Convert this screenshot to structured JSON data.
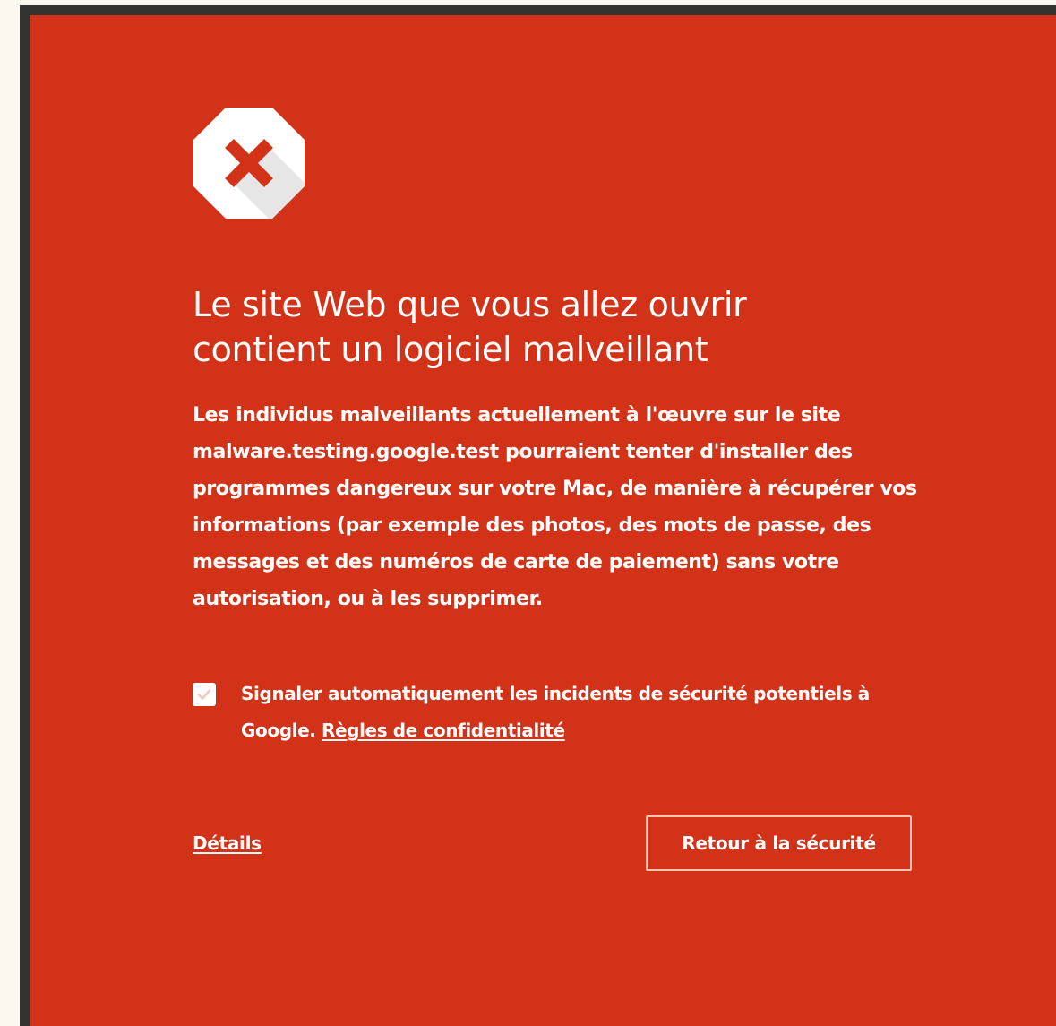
{
  "colors": {
    "panel_background": "#d23218",
    "outer_frame": "#333330",
    "page_background": "#fbf8ef",
    "text": "#ffffff"
  },
  "icon": {
    "name": "stop-sign-x-icon"
  },
  "heading": {
    "line1": "Le site Web que vous allez ouvrir",
    "line2": "contient un logiciel malveillant"
  },
  "message": {
    "intro": "Les individus malveillants actuellement à l'œuvre sur le site ",
    "site": "malware.testing.google.test",
    "rest": " pourraient tenter d'installer des programmes dangereux sur votre Mac, de manière à récupérer vos informations (par exemple des photos, des mots de passe, des messages et des numéros de carte de paiement) sans votre autorisation, ou à les supprimer."
  },
  "report": {
    "checked": true,
    "label": "Signaler automatiquement les incidents de sécurité potentiels à Google. ",
    "privacy_link": "Règles de confidentialité"
  },
  "actions": {
    "details_link": "Détails",
    "back_button": "Retour à la sécurité"
  }
}
